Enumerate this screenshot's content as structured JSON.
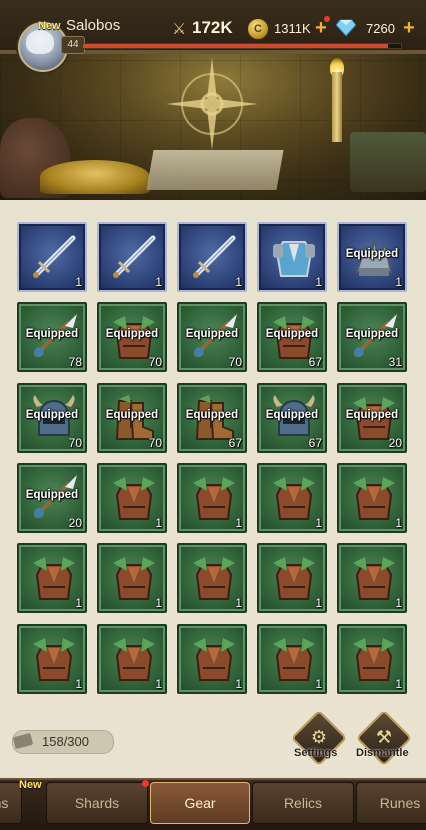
{
  "header": {
    "new_tag": "New",
    "player_name": "Salobos",
    "level": "44",
    "xp_fraction": 0.96,
    "power": "172K",
    "gold": "1311K",
    "gems": "7260",
    "coin_glyph": "C"
  },
  "inventory": {
    "equipped_label": "Equipped",
    "capacity": "158/300",
    "slots": [
      {
        "icon": "sword-icon",
        "theme": "blue",
        "equipped": false,
        "count": "1"
      },
      {
        "icon": "sword-icon",
        "theme": "blue",
        "equipped": false,
        "count": "1"
      },
      {
        "icon": "sword-icon",
        "theme": "blue",
        "equipped": false,
        "count": "1"
      },
      {
        "icon": "armor-icon",
        "theme": "blue",
        "equipped": false,
        "count": "1"
      },
      {
        "icon": "gauntlet-icon",
        "theme": "blue",
        "equipped": true,
        "count": "1"
      },
      {
        "icon": "spear-icon",
        "theme": "green",
        "equipped": true,
        "count": "78"
      },
      {
        "icon": "chest-armor-icon",
        "theme": "green",
        "equipped": true,
        "count": "70"
      },
      {
        "icon": "spear-icon",
        "theme": "green",
        "equipped": true,
        "count": "70"
      },
      {
        "icon": "chest-armor-icon",
        "theme": "green",
        "equipped": true,
        "count": "67"
      },
      {
        "icon": "spear-icon",
        "theme": "green",
        "equipped": true,
        "count": "31"
      },
      {
        "icon": "helmet-icon",
        "theme": "green",
        "equipped": true,
        "count": "70"
      },
      {
        "icon": "boots-icon",
        "theme": "green",
        "equipped": true,
        "count": "70"
      },
      {
        "icon": "boots-icon",
        "theme": "green",
        "equipped": true,
        "count": "67"
      },
      {
        "icon": "helmet-icon",
        "theme": "green",
        "equipped": true,
        "count": "67"
      },
      {
        "icon": "chest-armor-icon",
        "theme": "green",
        "equipped": true,
        "count": "20"
      },
      {
        "icon": "spear-icon",
        "theme": "green",
        "equipped": true,
        "count": "20"
      },
      {
        "icon": "chest-armor-icon",
        "theme": "green",
        "equipped": false,
        "count": "1"
      },
      {
        "icon": "chest-armor-icon",
        "theme": "green",
        "equipped": false,
        "count": "1"
      },
      {
        "icon": "chest-armor-icon",
        "theme": "green",
        "equipped": false,
        "count": "1"
      },
      {
        "icon": "chest-armor-icon",
        "theme": "green",
        "equipped": false,
        "count": "1"
      },
      {
        "icon": "chest-armor-icon",
        "theme": "green",
        "equipped": false,
        "count": "1"
      },
      {
        "icon": "chest-armor-icon",
        "theme": "green",
        "equipped": false,
        "count": "1"
      },
      {
        "icon": "chest-armor-icon",
        "theme": "green",
        "equipped": false,
        "count": "1"
      },
      {
        "icon": "chest-armor-icon",
        "theme": "green",
        "equipped": false,
        "count": "1"
      },
      {
        "icon": "chest-armor-icon",
        "theme": "green",
        "equipped": false,
        "count": "1"
      },
      {
        "icon": "chest-armor-icon",
        "theme": "green",
        "equipped": false,
        "count": "1"
      },
      {
        "icon": "chest-armor-icon",
        "theme": "green",
        "equipped": false,
        "count": "1"
      },
      {
        "icon": "chest-armor-icon",
        "theme": "green",
        "equipped": false,
        "count": "1"
      },
      {
        "icon": "chest-armor-icon",
        "theme": "green",
        "equipped": false,
        "count": "1"
      },
      {
        "icon": "chest-armor-icon",
        "theme": "green",
        "equipped": false,
        "count": "1"
      }
    ]
  },
  "actions": {
    "settings_label": "Settings",
    "dismantle_label": "Dismantle"
  },
  "nav": {
    "new_tag": "New",
    "tabs": [
      "ns",
      "Shards",
      "Gear",
      "Relics",
      "Runes"
    ],
    "active": "Gear"
  },
  "colors": {
    "accent": "#f1b431",
    "xp_bar": "#d04a2e",
    "blue_slot": "#2b3f74",
    "green_slot": "#2d5c35",
    "notification": "#e0412a"
  }
}
